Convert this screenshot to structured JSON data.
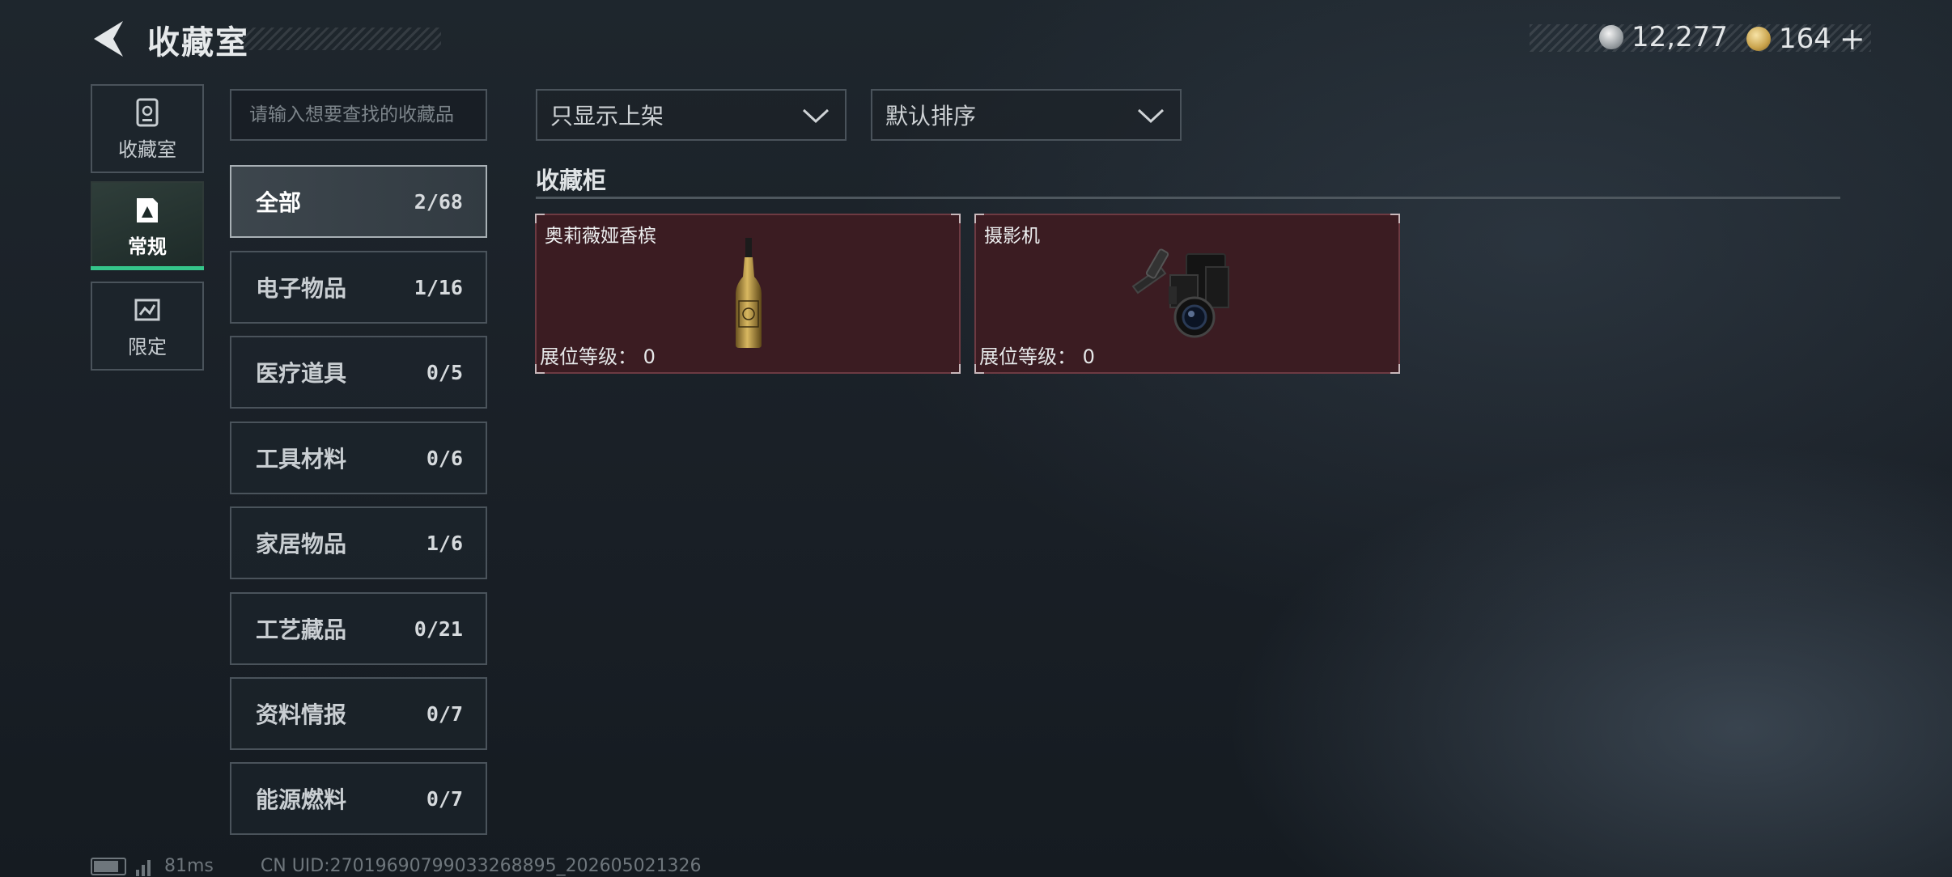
{
  "header": {
    "title": "收藏室",
    "silver_amount": "12,277",
    "gold_amount": "164",
    "add_symbol": "+"
  },
  "nav": [
    {
      "label": "收藏室",
      "icon": "collection-room-icon"
    },
    {
      "label": "常规",
      "icon": "regular-card-icon",
      "active": true
    },
    {
      "label": "限定",
      "icon": "limited-icon"
    }
  ],
  "search": {
    "placeholder": "请输入想要查找的收藏品"
  },
  "filters": {
    "show_filter": "只显示上架",
    "sort": "默认排序"
  },
  "categories": [
    {
      "name": "全部",
      "count": "2/68",
      "active": true
    },
    {
      "name": "电子物品",
      "count": "1/16"
    },
    {
      "name": "医疗道具",
      "count": "0/5"
    },
    {
      "name": "工具材料",
      "count": "0/6"
    },
    {
      "name": "家居物品",
      "count": "1/6"
    },
    {
      "name": "工艺藏品",
      "count": "0/21"
    },
    {
      "name": "资料情报",
      "count": "0/7"
    },
    {
      "name": "能源燃料",
      "count": "0/7"
    }
  ],
  "cabinet": {
    "title": "收藏柜",
    "items": [
      {
        "name": "奥莉薇娅香槟",
        "level_label": "展位等级：",
        "level": "0",
        "icon": "champagne-bottle-icon"
      },
      {
        "name": "摄影机",
        "level_label": "展位等级：",
        "level": "0",
        "icon": "video-camera-icon"
      }
    ]
  },
  "footer": {
    "ping": "81ms",
    "uid": "CN UID:27019690799033268895_202605021326"
  },
  "colors": {
    "accent_green": "#35c58a",
    "card_bg": "#3b1c22"
  }
}
